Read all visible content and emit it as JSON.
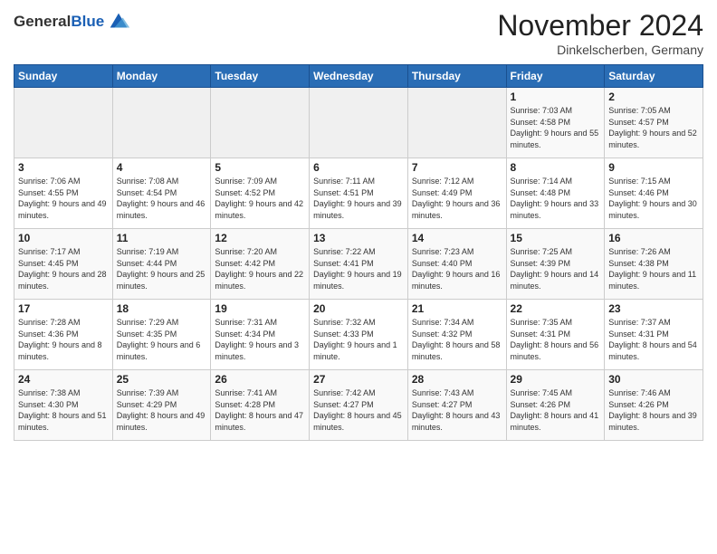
{
  "header": {
    "logo_general": "General",
    "logo_blue": "Blue",
    "month_title": "November 2024",
    "location": "Dinkelscherben, Germany"
  },
  "calendar": {
    "days_of_week": [
      "Sunday",
      "Monday",
      "Tuesday",
      "Wednesday",
      "Thursday",
      "Friday",
      "Saturday"
    ],
    "weeks": [
      [
        {
          "day": "",
          "empty": true
        },
        {
          "day": "",
          "empty": true
        },
        {
          "day": "",
          "empty": true
        },
        {
          "day": "",
          "empty": true
        },
        {
          "day": "",
          "empty": true
        },
        {
          "day": "1",
          "sunrise": "7:03 AM",
          "sunset": "4:58 PM",
          "daylight": "9 hours and 55 minutes."
        },
        {
          "day": "2",
          "sunrise": "7:05 AM",
          "sunset": "4:57 PM",
          "daylight": "9 hours and 52 minutes."
        }
      ],
      [
        {
          "day": "3",
          "sunrise": "7:06 AM",
          "sunset": "4:55 PM",
          "daylight": "9 hours and 49 minutes."
        },
        {
          "day": "4",
          "sunrise": "7:08 AM",
          "sunset": "4:54 PM",
          "daylight": "9 hours and 46 minutes."
        },
        {
          "day": "5",
          "sunrise": "7:09 AM",
          "sunset": "4:52 PM",
          "daylight": "9 hours and 42 minutes."
        },
        {
          "day": "6",
          "sunrise": "7:11 AM",
          "sunset": "4:51 PM",
          "daylight": "9 hours and 39 minutes."
        },
        {
          "day": "7",
          "sunrise": "7:12 AM",
          "sunset": "4:49 PM",
          "daylight": "9 hours and 36 minutes."
        },
        {
          "day": "8",
          "sunrise": "7:14 AM",
          "sunset": "4:48 PM",
          "daylight": "9 hours and 33 minutes."
        },
        {
          "day": "9",
          "sunrise": "7:15 AM",
          "sunset": "4:46 PM",
          "daylight": "9 hours and 30 minutes."
        }
      ],
      [
        {
          "day": "10",
          "sunrise": "7:17 AM",
          "sunset": "4:45 PM",
          "daylight": "9 hours and 28 minutes."
        },
        {
          "day": "11",
          "sunrise": "7:19 AM",
          "sunset": "4:44 PM",
          "daylight": "9 hours and 25 minutes."
        },
        {
          "day": "12",
          "sunrise": "7:20 AM",
          "sunset": "4:42 PM",
          "daylight": "9 hours and 22 minutes."
        },
        {
          "day": "13",
          "sunrise": "7:22 AM",
          "sunset": "4:41 PM",
          "daylight": "9 hours and 19 minutes."
        },
        {
          "day": "14",
          "sunrise": "7:23 AM",
          "sunset": "4:40 PM",
          "daylight": "9 hours and 16 minutes."
        },
        {
          "day": "15",
          "sunrise": "7:25 AM",
          "sunset": "4:39 PM",
          "daylight": "9 hours and 14 minutes."
        },
        {
          "day": "16",
          "sunrise": "7:26 AM",
          "sunset": "4:38 PM",
          "daylight": "9 hours and 11 minutes."
        }
      ],
      [
        {
          "day": "17",
          "sunrise": "7:28 AM",
          "sunset": "4:36 PM",
          "daylight": "9 hours and 8 minutes."
        },
        {
          "day": "18",
          "sunrise": "7:29 AM",
          "sunset": "4:35 PM",
          "daylight": "9 hours and 6 minutes."
        },
        {
          "day": "19",
          "sunrise": "7:31 AM",
          "sunset": "4:34 PM",
          "daylight": "9 hours and 3 minutes."
        },
        {
          "day": "20",
          "sunrise": "7:32 AM",
          "sunset": "4:33 PM",
          "daylight": "9 hours and 1 minute."
        },
        {
          "day": "21",
          "sunrise": "7:34 AM",
          "sunset": "4:32 PM",
          "daylight": "8 hours and 58 minutes."
        },
        {
          "day": "22",
          "sunrise": "7:35 AM",
          "sunset": "4:31 PM",
          "daylight": "8 hours and 56 minutes."
        },
        {
          "day": "23",
          "sunrise": "7:37 AM",
          "sunset": "4:31 PM",
          "daylight": "8 hours and 54 minutes."
        }
      ],
      [
        {
          "day": "24",
          "sunrise": "7:38 AM",
          "sunset": "4:30 PM",
          "daylight": "8 hours and 51 minutes."
        },
        {
          "day": "25",
          "sunrise": "7:39 AM",
          "sunset": "4:29 PM",
          "daylight": "8 hours and 49 minutes."
        },
        {
          "day": "26",
          "sunrise": "7:41 AM",
          "sunset": "4:28 PM",
          "daylight": "8 hours and 47 minutes."
        },
        {
          "day": "27",
          "sunrise": "7:42 AM",
          "sunset": "4:27 PM",
          "daylight": "8 hours and 45 minutes."
        },
        {
          "day": "28",
          "sunrise": "7:43 AM",
          "sunset": "4:27 PM",
          "daylight": "8 hours and 43 minutes."
        },
        {
          "day": "29",
          "sunrise": "7:45 AM",
          "sunset": "4:26 PM",
          "daylight": "8 hours and 41 minutes."
        },
        {
          "day": "30",
          "sunrise": "7:46 AM",
          "sunset": "4:26 PM",
          "daylight": "8 hours and 39 minutes."
        }
      ]
    ]
  }
}
